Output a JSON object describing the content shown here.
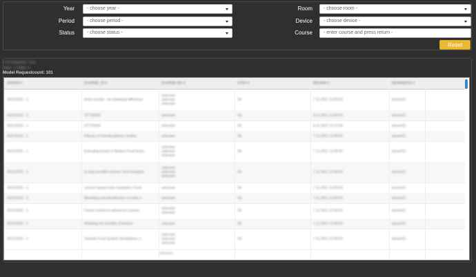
{
  "filters": {
    "year": {
      "label": "Year",
      "placeholder": "- choose year -"
    },
    "period": {
      "label": "Period",
      "placeholder": "- choose period -"
    },
    "status": {
      "label": "Status",
      "placeholder": "- choose status -"
    },
    "room": {
      "label": "Room",
      "placeholder": "- choose room -"
    },
    "device": {
      "label": "Device",
      "placeholder": "- choose device -"
    },
    "course": {
      "label": "Course",
      "placeholder": "- enter course and press return -"
    }
  },
  "reset_label": "Reset",
  "summary": {
    "line1": "# of requests: 101",
    "line2": "Year: 0  Step: 0",
    "line3": "Model Requestcount: 101"
  },
  "table": {
    "headers": [
      "ERROR #",
      "COURSE_ID #",
      "COURSE NO #",
      "STEP #",
      "BEGINN #",
      "BEARBEITE #"
    ],
    "rows": [
      [
        "2021/2022 - 1",
        "Entry module - for individual difference",
        "unknown\nunknown\nunknown",
        "Ok",
        "7.11.2021 13:00:00",
        "tstuser01"
      ],
      [
        "2021/2022 - 1",
        "CFT05000",
        "unknown",
        "Ok",
        "8.11.2021 13:00:00",
        "tstuser01"
      ],
      [
        "2021/2022 - 1",
        "CFT05000",
        "unknown",
        "Ok",
        "8.11.2021 13:12:00",
        "tstuser01"
      ],
      [
        "2021/2022 - 1",
        "Efficacy of interdisciplinary studies",
        "unknown",
        "Ok",
        "7.11.2021 13:00:00",
        "tstuser01"
      ],
      [
        "2021/2022 - 1",
        "Emerging trends in Modern Food Scien",
        "unknown\nunknown\nunknown",
        "Ok",
        "7.11.2021 13:00:00",
        "tstuser01"
      ],
      [
        "2021/2022 - 1",
        "Iq step possible science: food navigatio",
        "unknown\nunknown\nunknown",
        "Ok",
        "7.11.2021 13:00:00",
        "tstuser01"
      ],
      [
        "2021/2022 - 1",
        "Lecture based route navigation: Food",
        "unknown",
        "Ok",
        "7.11.2021 13:00:00",
        "tstuser01"
      ],
      [
        "2021/2022 - 1",
        "Modelling and identification of water s",
        "unknown",
        "Ok",
        "7.11.2021 13:00:00",
        "tstuser01"
      ],
      [
        "2021/2022 - 1",
        "Falcon content in advanced courses",
        "unknown\nunknown",
        "Ok",
        "7.11.2021 13:00:00",
        "tstuser01"
      ],
      [
        "2021/2022 - 1",
        "Modeling the benefits of biotech",
        "unknown",
        "Ok",
        "7.11.2021 13:00:00",
        "tstuser01"
      ],
      [
        "2021/2022 - 1",
        "Towards Food System Simulations: 1.",
        "unknown\nunknown\nunknown",
        "Ok",
        "7.11.2021 13:00:00",
        "tstuser01"
      ]
    ],
    "trailing": "unknown"
  }
}
